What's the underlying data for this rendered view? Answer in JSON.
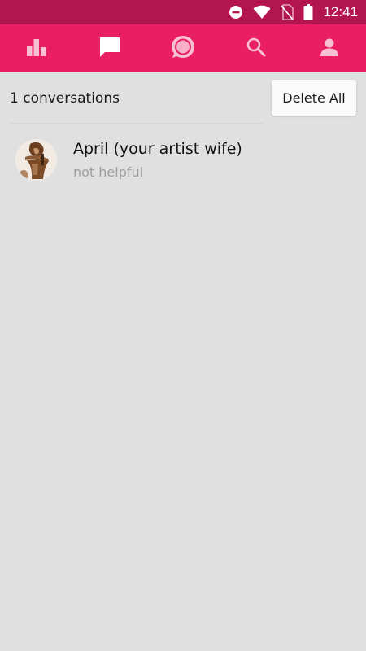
{
  "status_bar": {
    "time": "12:41",
    "icons": [
      "do-not-disturb-icon",
      "wifi-icon",
      "no-sim-icon",
      "battery-icon"
    ]
  },
  "nav": {
    "tabs": [
      {
        "icon": "bar-chart-icon",
        "active": false
      },
      {
        "icon": "message-icon",
        "active": true
      },
      {
        "icon": "chat-bubble-icon",
        "active": false
      },
      {
        "icon": "search-icon",
        "active": false
      },
      {
        "icon": "profile-icon",
        "active": false
      }
    ]
  },
  "conversations_header": {
    "count_text": "1 conversations",
    "delete_all_label": "Delete All"
  },
  "conversations": [
    {
      "name": "April (your artist wife)",
      "preview": "not helpful",
      "avatar_icon": "avatar-icon"
    }
  ],
  "colors": {
    "status_bar": "#b3164e",
    "nav_bar": "#e91e63",
    "background": "#e0e0e0",
    "preview_text": "#9e9e9e"
  }
}
